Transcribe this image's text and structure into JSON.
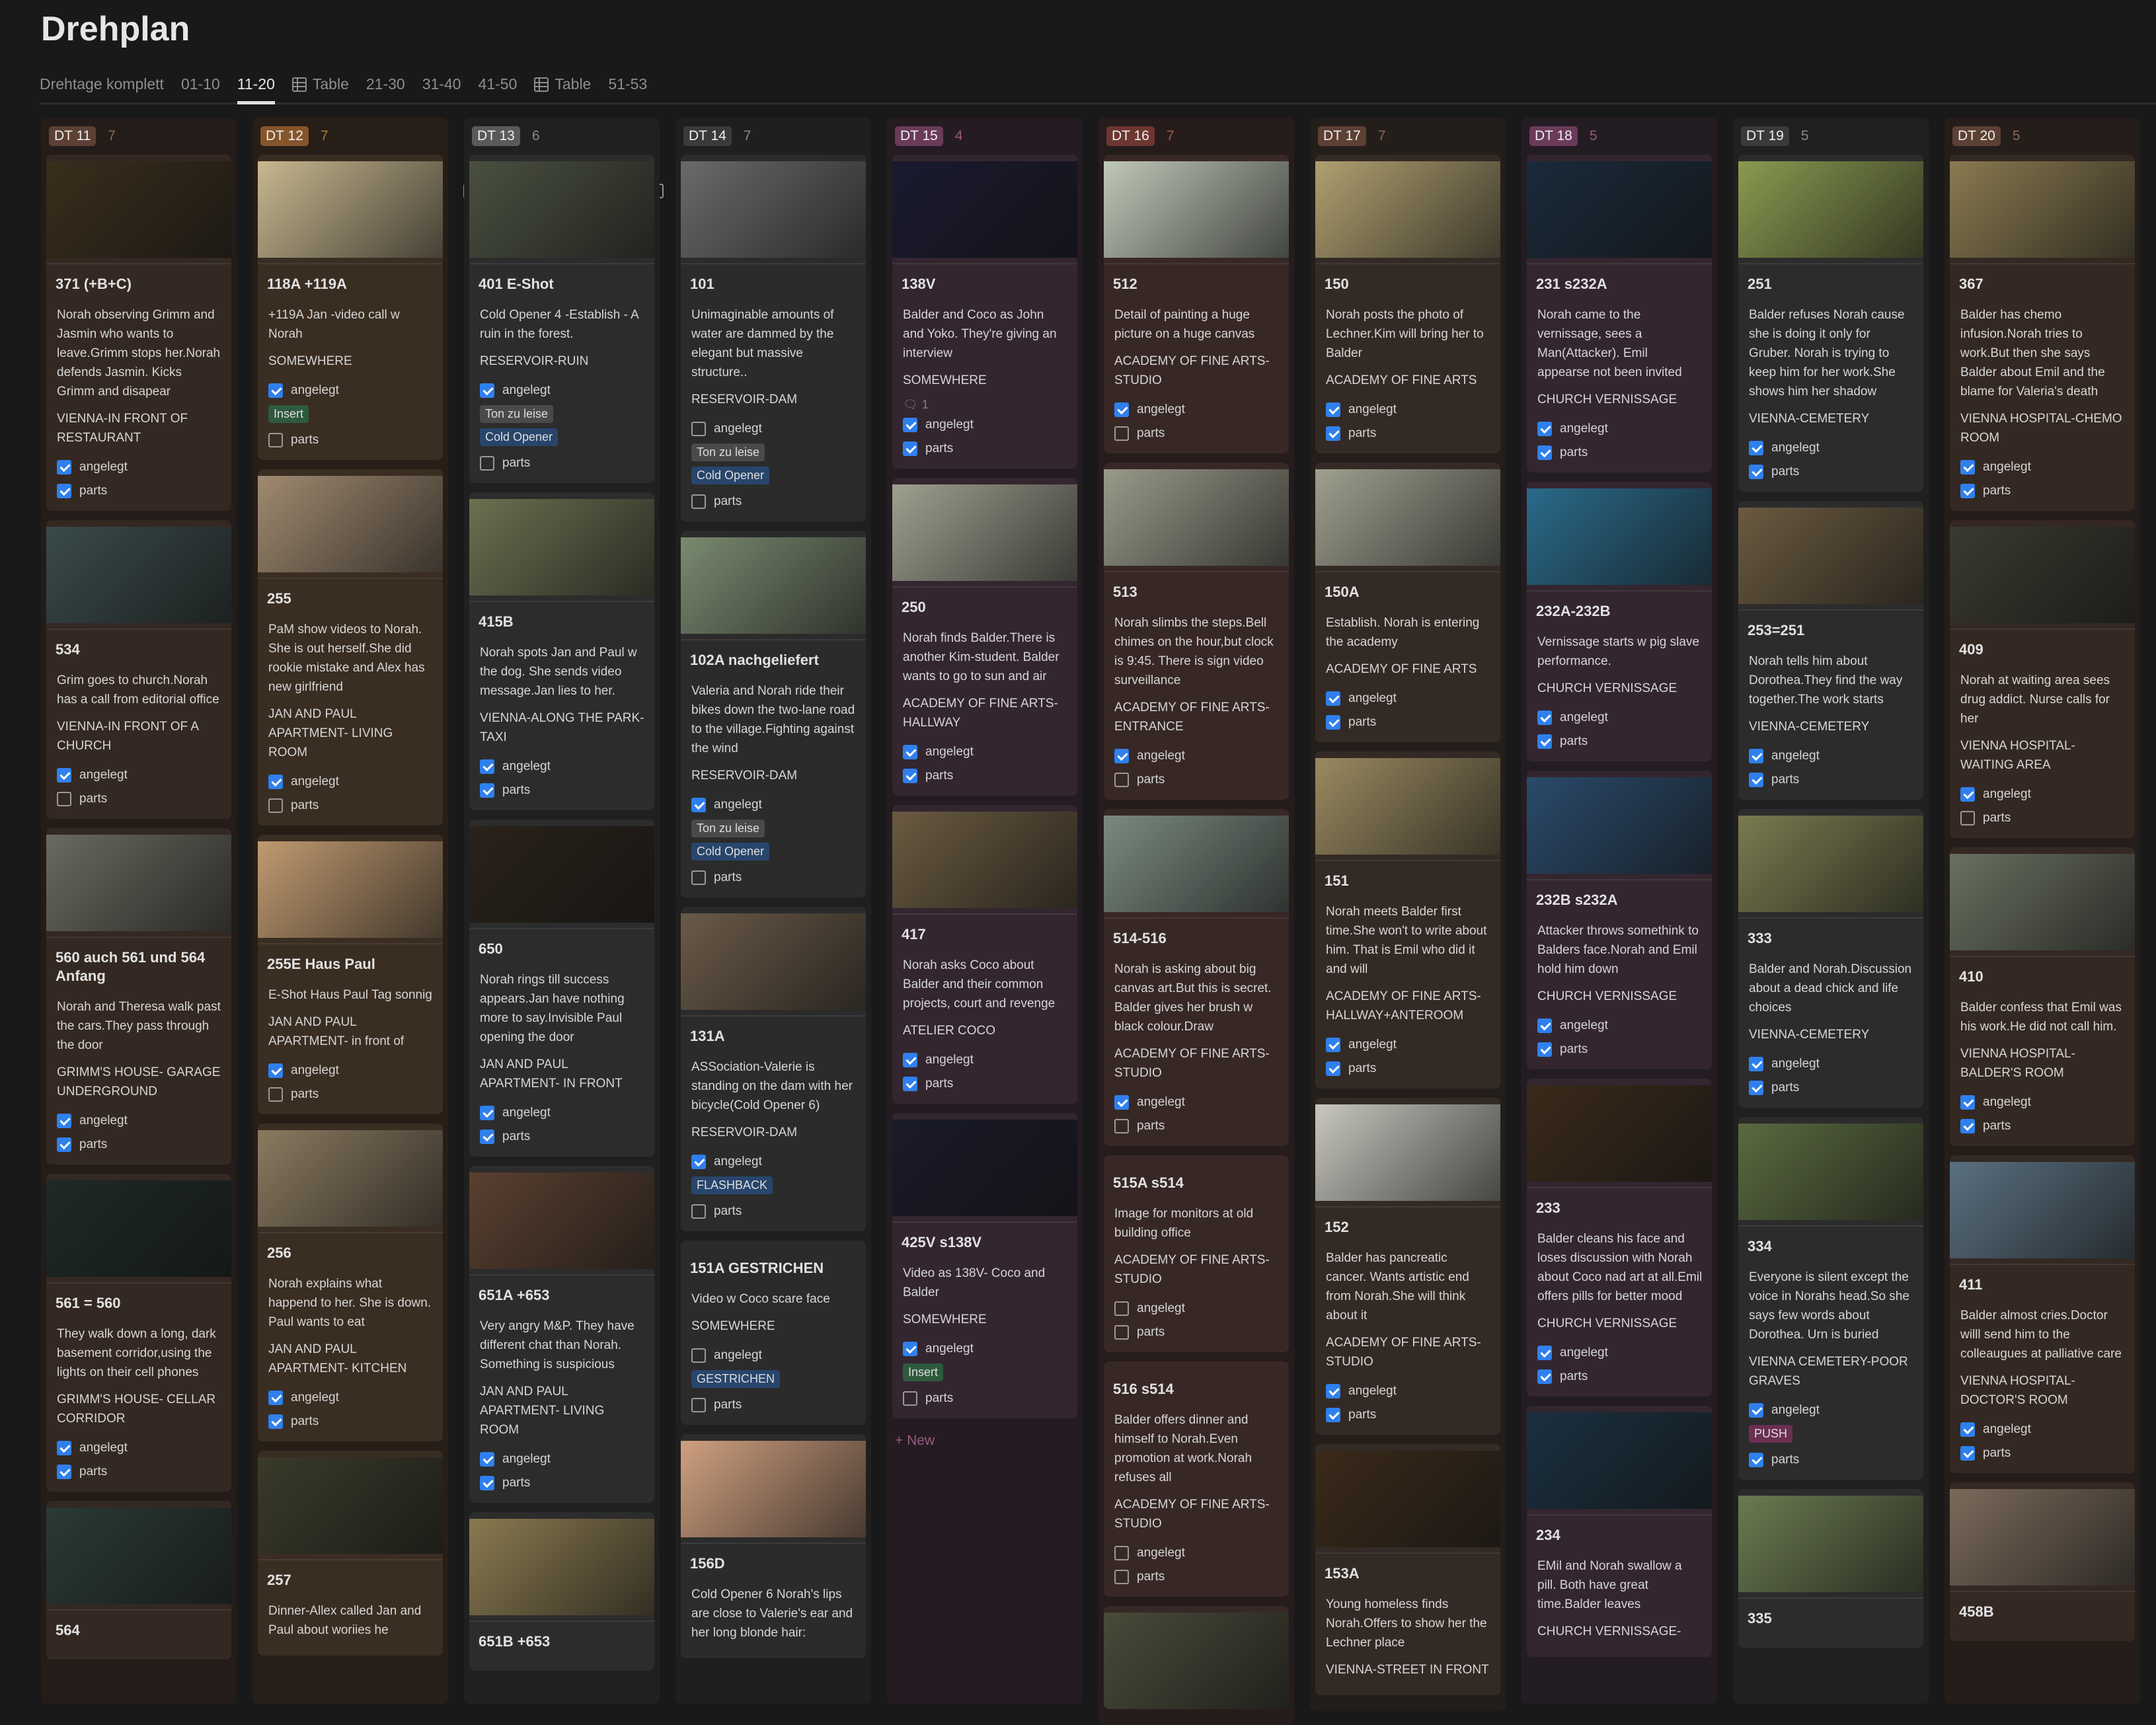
{
  "page": {
    "title": "Drehplan"
  },
  "tabs": [
    {
      "label": "Drehtage komplett",
      "icon": "board"
    },
    {
      "label": "01-10",
      "icon": "board"
    },
    {
      "label": "11-20",
      "icon": "board",
      "active": true
    },
    {
      "label": "Table",
      "icon": "table"
    },
    {
      "label": "21-30",
      "icon": "board"
    },
    {
      "label": "31-40",
      "icon": "board"
    },
    {
      "label": "41-50",
      "icon": "board"
    },
    {
      "label": "Table",
      "icon": "table"
    },
    {
      "label": "51-53",
      "icon": "board"
    }
  ],
  "labels": {
    "angelegt": "angelegt",
    "parts": "parts",
    "new": "+ New"
  },
  "tag_colors": {
    "Insert": "#2e5a3e",
    "Ton zu leise": "#4a4a4a",
    "Cold Opener": "#28456c",
    "FLASHBACK": "#28456c",
    "GESTRICHEN": "#28456c",
    "PUSH": "#6b2f52"
  },
  "columns": [
    {
      "name": "DT 11",
      "count": "7",
      "colors": {
        "bg": "#231c18",
        "card": "#342822",
        "tag": "#5c4033",
        "count": "#8a6a58"
      },
      "cards": [
        {
          "title": "371 (+B+C)",
          "thumb": "#3a2e1c",
          "desc": "Norah observing Grimm and Jasmin who wants to leave.Grimm stops her.Norah defends Jasmin. Kicks Grimm and disapear",
          "loc": "VIENNA-IN FRONT OF RESTAURANT",
          "angelegt": true,
          "parts": true
        },
        {
          "title": "534",
          "thumb": "#3a4a4a",
          "desc": "Grim goes to church.Norah has a call from editorial office",
          "loc": "VIENNA-IN FRONT OF A CHURCH",
          "angelegt": true,
          "parts": false
        },
        {
          "title": "560 auch 561 und 564 Anfang",
          "thumb": "#6a6a60",
          "desc": "Norah and Theresa walk past the cars.They pass through the door",
          "loc": "GRIMM'S HOUSE- GARAGE UNDERGROUND",
          "angelegt": true,
          "parts": true
        },
        {
          "title": "561 = 560",
          "thumb": "#1e2a26",
          "desc": "They walk down a long, dark basement corridor,using the lights on their cell phones",
          "loc": "GRIMM'S HOUSE- CELLAR CORRIDOR",
          "angelegt": true,
          "parts": true
        },
        {
          "title": "564",
          "thumb": "#2a3a36"
        }
      ]
    },
    {
      "name": "DT 12",
      "count": "7",
      "colors": {
        "bg": "#261e17",
        "card": "#3a2d22",
        "tag": "#84552a",
        "count": "#b07a3c"
      },
      "cards": [
        {
          "title": "118A +119A",
          "thumb": "#c8b890",
          "desc": "+119A  Jan -video call w Norah",
          "loc": "SOMEWHERE",
          "angelegt": true,
          "tags": [
            "Insert"
          ],
          "parts": false
        },
        {
          "title": "255",
          "thumb": "#a08a70",
          "desc": "PaM show videos to Norah. She is out herself.She did rookie mistake and Alex has new girlfriend",
          "loc": "JAN AND PAUL APARTMENT- LIVING ROOM",
          "angelegt": true,
          "parts": false
        },
        {
          "title": "255E Haus Paul",
          "thumb": "#c09a70",
          "desc": "E-Shot Haus Paul Tag sonnig",
          "loc": "JAN AND PAUL APARTMENT- in front of",
          "angelegt": true,
          "parts": false
        },
        {
          "title": "256",
          "thumb": "#8a7a60",
          "desc": "Norah explains what happend to her. She is down. Paul wants to eat",
          "loc": "JAN AND PAUL APARTMENT- KITCHEN",
          "angelegt": true,
          "parts": true
        },
        {
          "title": "257",
          "thumb": "#3a3a2a",
          "desc": "Dinner-Allex called Jan and Paul about woriies he"
        }
      ]
    },
    {
      "name": "DT 13",
      "count": "6",
      "colors": {
        "bg": "#202020",
        "card": "#2c2c2c",
        "tag": "#5a5a5a",
        "count": "#8a8a8a"
      },
      "cards": [
        {
          "title": "401  E-Shot",
          "thumb": "#4a5040",
          "desc": "Cold Opener 4 -Establish - A ruin in the forest.",
          "loc": "RESERVOIR-RUIN",
          "angelegt": true,
          "tags": [
            "Ton zu leise",
            "Cold Opener"
          ],
          "parts": false
        },
        {
          "title": "415B",
          "thumb": "#6a7050",
          "desc": "Norah spots Jan and Paul w the dog. She sends video message.Jan lies to her.",
          "loc": "VIENNA-ALONG THE PARK-TAXI",
          "angelegt": true,
          "parts": true
        },
        {
          "title": "650",
          "thumb": "#2a221a",
          "desc": "Norah rings till success appears.Jan have nothing more to say.Invisible Paul opening the door",
          "loc": "JAN AND PAUL APARTMENT- IN FRONT",
          "angelegt": true,
          "parts": true
        },
        {
          "title": "651A +653",
          "thumb": "#5a4030",
          "desc": "Very angry M&P. They have different chat than Norah. Something is suspicious",
          "loc": "JAN AND PAUL APARTMENT- LIVING ROOM",
          "angelegt": true,
          "parts": true
        },
        {
          "title": "651B +653",
          "thumb": "#8a7a50"
        }
      ]
    },
    {
      "name": "DT 14",
      "count": "7",
      "colors": {
        "bg": "#1f1f1f",
        "card": "#2b2b2b",
        "tag": "#3a3a3a",
        "count": "#8a8a8a"
      },
      "cards": [
        {
          "title": "101",
          "thumb": "#6a6a6a",
          "desc": "Unimaginable amounts of water are dammed by the elegant but massive structure..",
          "loc": "RESERVOIR-DAM",
          "angelegt": false,
          "tags": [
            "Ton zu leise",
            "Cold Opener"
          ],
          "parts": false
        },
        {
          "title": "102A nachgeliefert",
          "thumb": "#7a8a70",
          "desc": "Valeria and Norah ride their bikes down the two-lane road to the village.Fighting against the wind",
          "loc": "RESERVOIR-DAM",
          "angelegt": true,
          "tags": [
            "Ton zu leise",
            "Cold Opener"
          ],
          "parts": false
        },
        {
          "title": "131A",
          "thumb": "#6a5a48",
          "desc": "ASSociation-Valerie is standing on the dam with her bicycle(Cold Opener 6)",
          "loc": "RESERVOIR-DAM",
          "angelegt": true,
          "tags": [
            "FLASHBACK"
          ],
          "parts": false
        },
        {
          "title": "151A GESTRICHEN",
          "desc": "Video w Coco scare face",
          "loc": "SOMEWHERE",
          "angelegt": false,
          "tags": [
            "GESTRICHEN"
          ],
          "parts": false
        },
        {
          "title": "156D",
          "thumb": "#d0a080",
          "desc": "Cold Opener 6 Norah's lips are close to Valerie's ear and her long blonde hair:"
        }
      ]
    },
    {
      "name": "DT 15",
      "count": "4",
      "colors": {
        "bg": "#241c22",
        "card": "#33262f",
        "tag": "#6a3a5a",
        "count": "#9a5a80"
      },
      "new": true,
      "cards": [
        {
          "title": "138V",
          "thumb": "#1a1a30",
          "desc": "Balder and Coco as John and Yoko. They're giving an interview",
          "loc": "SOMEWHERE",
          "angelegt": true,
          "parts": true,
          "comments": "1"
        },
        {
          "title": "250",
          "thumb": "#a0a090",
          "desc": "Norah finds Balder.There is another Kim-student. Balder wants to go to sun and air",
          "loc": "ACADEMY OF FINE ARTS-HALLWAY",
          "angelegt": true,
          "parts": true
        },
        {
          "title": "417",
          "thumb": "#6a5a40",
          "desc": "Norah asks Coco about Balder and their common projects, court and revenge",
          "loc": "ATELIER COCO",
          "angelegt": true,
          "parts": true
        },
        {
          "title": "425V s138V",
          "thumb": "#1a1a2a",
          "desc": "Video as 138V- Coco and Balder",
          "loc": "SOMEWHERE",
          "angelegt": true,
          "tags": [
            "Insert"
          ],
          "parts": false
        }
      ]
    },
    {
      "name": "DT 16",
      "count": "7",
      "colors": {
        "bg": "#261c1b",
        "card": "#372826",
        "tag": "#6e3630",
        "count": "#a05a50"
      },
      "cards": [
        {
          "title": "512",
          "thumb": "#c0c8b8",
          "desc": "Detail of painting a huge picture on a huge canvas",
          "loc": "ACADEMY OF FINE ARTS-STUDIO",
          "angelegt": true,
          "parts": false
        },
        {
          "title": "513",
          "thumb": "#9a9a8a",
          "desc": "Norah slimbs the steps.Bell chimes on the hour,but clock is 9:45. There is sign video surveillance",
          "loc": "ACADEMY OF FINE ARTS-ENTRANCE",
          "angelegt": true,
          "parts": false
        },
        {
          "title": "514-516",
          "thumb": "#7a8a80",
          "desc": "Norah is asking about big canvas art.But this is secret. Balder gives her brush w  black colour.Draw",
          "loc": "ACADEMY OF FINE ARTS-STUDIO",
          "angelegt": true,
          "parts": false
        },
        {
          "title": "515A s514",
          "desc": "Image for monitors at old building office",
          "loc": "ACADEMY OF FINE ARTS-STUDIO",
          "angelegt": false,
          "parts": false
        },
        {
          "title": "516 s514",
          "desc": "Balder offers dinner and himself to Norah.Even promotion at work.Norah refuses all",
          "loc": "ACADEMY OF FINE ARTS-STUDIO",
          "angelegt": false,
          "parts": false
        },
        {
          "thumb": "#4a4a3a"
        }
      ]
    },
    {
      "name": "DT 17",
      "count": "7",
      "colors": {
        "bg": "#241e1b",
        "card": "#342a25",
        "tag": "#5c4033",
        "count": "#8a6a58"
      },
      "cards": [
        {
          "title": "150",
          "thumb": "#b0a070",
          "desc": "Norah posts the photo of Lechner.Kim will bring her to Balder",
          "loc": "ACADEMY OF FINE ARTS",
          "angelegt": true,
          "parts": true
        },
        {
          "title": "150A",
          "thumb": "#a0a090",
          "desc": "Establish. Norah is entering the academy",
          "loc": "ACADEMY OF FINE ARTS",
          "angelegt": true,
          "parts": true
        },
        {
          "title": "151",
          "thumb": "#9a8a60",
          "desc": "Norah meets Balder first time.She won't to write about him. That is Emil who did it and will",
          "loc": "ACADEMY OF FINE ARTS-HALLWAY+ANTEROOM",
          "angelegt": true,
          "parts": true
        },
        {
          "title": "152",
          "thumb": "#c8c8c0",
          "desc": "Balder has pancreatic cancer. Wants artistic end from Norah.She will think about it",
          "loc": "ACADEMY OF FINE ARTS-STUDIO",
          "angelegt": true,
          "parts": true
        },
        {
          "title": "153A",
          "thumb": "#3a2a1a",
          "desc": "Young homeless finds Norah.Offers to show her the Lechner place",
          "loc": "VIENNA-STREET IN FRONT"
        }
      ]
    },
    {
      "name": "DT 18",
      "count": "5",
      "colors": {
        "bg": "#241c23",
        "card": "#33262f",
        "tag": "#6a3a5a",
        "count": "#9a5a80"
      },
      "cards": [
        {
          "title": "231 s232A",
          "thumb": "#1a2a3a",
          "desc": "Norah came to the vernissage, sees a Man(Attacker). Emil appearse not been invited",
          "loc": "CHURCH VERNISSAGE",
          "angelegt": true,
          "parts": true
        },
        {
          "title": "232A-232B",
          "thumb": "#2a6a8a",
          "desc": "Vernissage starts w pig slave performance.",
          "loc": "CHURCH VERNISSAGE",
          "angelegt": true,
          "parts": true
        },
        {
          "title": "232B s232A",
          "thumb": "#2a4a6a",
          "desc": "Attacker throws somethink to Balders face.Norah and Emil hold him down",
          "loc": "CHURCH VERNISSAGE",
          "angelegt": true,
          "parts": true
        },
        {
          "title": "233",
          "thumb": "#3a2a1a",
          "desc": "Balder cleans his face and loses discussion with Norah about Coco nad art at all.Emil offers pills for better mood",
          "loc": "CHURCH VERNISSAGE",
          "angelegt": true,
          "parts": true
        },
        {
          "title": "234",
          "thumb": "#1a3040",
          "desc": "EMil and Norah swallow a pill. Both have great time.Balder leaves",
          "loc": "CHURCH VERNISSAGE-"
        }
      ]
    },
    {
      "name": "DT 19",
      "count": "5",
      "colors": {
        "bg": "#202020",
        "card": "#2c2c2c",
        "tag": "#3a3a3a",
        "count": "#8a8a8a"
      },
      "cards": [
        {
          "title": "251",
          "thumb": "#8a9a50",
          "desc": "Balder refuses Norah cause she is doing it only for Gruber. Norah is trying to keep him for her work.She shows him her shadow",
          "loc": "VIENNA-CEMETERY",
          "angelegt": true,
          "parts": true
        },
        {
          "title": "253=251",
          "thumb": "#6a5a40",
          "desc": "Norah tells him about Dorothea.They find the way together.The work starts",
          "loc": "VIENNA-CEMETERY",
          "angelegt": true,
          "parts": true
        },
        {
          "title": "333",
          "thumb": "#7a7a50",
          "desc": "Balder and Norah.Discussion about a dead chick and life choices",
          "loc": "VIENNA-CEMETERY",
          "angelegt": true,
          "parts": true
        },
        {
          "title": "334",
          "thumb": "#5a6a40",
          "desc": "Everyone is silent except the voice in Norahs head.So she says few words about Dorothea. Urn is buried",
          "loc": "VIENNA CEMETERY-POOR GRAVES",
          "angelegt": true,
          "tags": [
            "PUSH"
          ],
          "parts": true
        },
        {
          "title": "335",
          "thumb": "#6a7a50"
        }
      ]
    },
    {
      "name": "DT 20",
      "count": "5",
      "colors": {
        "bg": "#241d1a",
        "card": "#342823",
        "tag": "#5c4033",
        "count": "#8a6a58"
      },
      "cards": [
        {
          "title": "367",
          "thumb": "#8a7a50",
          "desc": "Balder has chemo infusion.Norah tries to work.But then she says Balder about Emil and the blame for Valeria's death",
          "loc": "VIENNA HOSPITAL-CHEMO ROOM",
          "angelegt": true,
          "parts": true
        },
        {
          "title": "409",
          "thumb": "#3a3a30",
          "desc": "Norah at waiting area sees drug addict. Nurse calls for her",
          "loc": "VIENNA HOSPITAL-WAITING AREA",
          "angelegt": true,
          "parts": false
        },
        {
          "title": "410",
          "thumb": "#6a7060",
          "desc": "Balder confess that Emil was his work.He did not call him.",
          "loc": "VIENNA HOSPITAL-BALDER'S ROOM",
          "angelegt": true,
          "parts": true
        },
        {
          "title": "411",
          "thumb": "#5a7080",
          "desc": "Balder almost cries.Doctor willl send him to the colleaugues at palliative care",
          "loc": "VIENNA HOSPITAL-DOCTOR'S ROOM",
          "angelegt": true,
          "parts": true
        },
        {
          "title": "458B",
          "thumb": "#7a6a5a"
        }
      ]
    }
  ]
}
